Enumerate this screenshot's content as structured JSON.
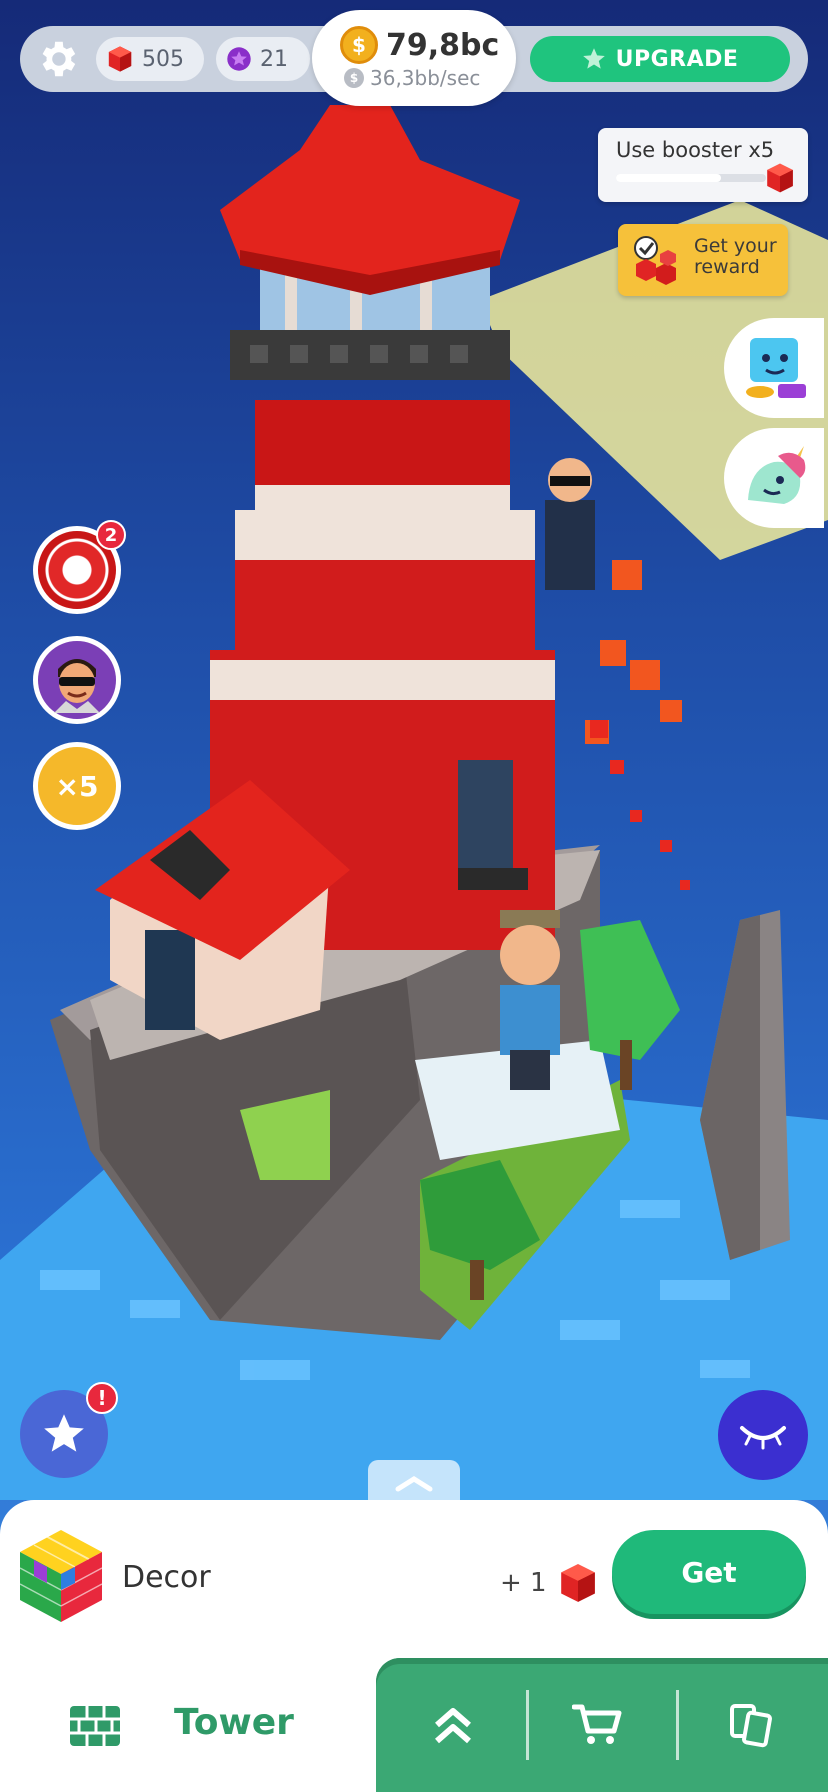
{
  "topbar": {
    "gems": "505",
    "stars": "21",
    "money": "79,8bc",
    "income": "36,3bb/sec",
    "upgrade_label": "UPGRADE"
  },
  "side": {
    "booster_label": "Use booster x5",
    "booster_progress": 0.7,
    "reward_label": "Get your reward",
    "wheel_badge": "2",
    "x5_label": "×5"
  },
  "alert_badge": "!",
  "sheet": {
    "item_label": "Decor",
    "gain_label": "+ 1",
    "get_label": "Get"
  },
  "nav": {
    "tower_label": "Tower"
  },
  "colors": {
    "accent_green": "#1fc47e",
    "nav_green": "#3ba874",
    "gem_red": "#e02424",
    "sky_top": "#152a78",
    "sky_bottom": "#3d8be0"
  },
  "icons": [
    "gear-icon",
    "gem-icon",
    "star-icon",
    "coin-icon",
    "cart-icon",
    "chevrons-up-icon",
    "cards-icon",
    "bricks-icon",
    "eye-closed-icon"
  ]
}
